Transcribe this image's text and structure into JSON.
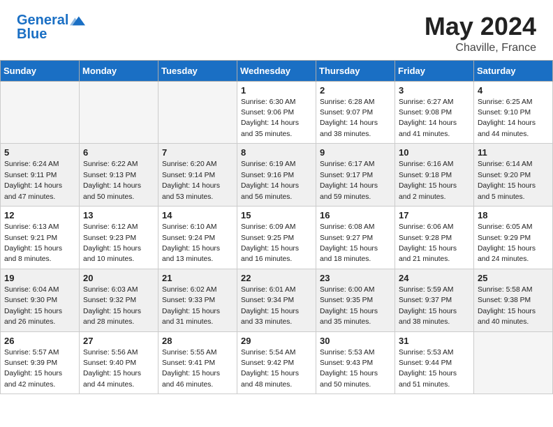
{
  "header": {
    "logo_line1": "General",
    "logo_line2": "Blue",
    "month": "May 2024",
    "location": "Chaville, France"
  },
  "weekdays": [
    "Sunday",
    "Monday",
    "Tuesday",
    "Wednesday",
    "Thursday",
    "Friday",
    "Saturday"
  ],
  "weeks": [
    [
      {
        "day": "",
        "sunrise": "",
        "sunset": "",
        "daylight": "",
        "empty": true
      },
      {
        "day": "",
        "sunrise": "",
        "sunset": "",
        "daylight": "",
        "empty": true
      },
      {
        "day": "",
        "sunrise": "",
        "sunset": "",
        "daylight": "",
        "empty": true
      },
      {
        "day": "1",
        "sunrise": "Sunrise: 6:30 AM",
        "sunset": "Sunset: 9:06 PM",
        "daylight": "Daylight: 14 hours and 35 minutes.",
        "empty": false
      },
      {
        "day": "2",
        "sunrise": "Sunrise: 6:28 AM",
        "sunset": "Sunset: 9:07 PM",
        "daylight": "Daylight: 14 hours and 38 minutes.",
        "empty": false
      },
      {
        "day": "3",
        "sunrise": "Sunrise: 6:27 AM",
        "sunset": "Sunset: 9:08 PM",
        "daylight": "Daylight: 14 hours and 41 minutes.",
        "empty": false
      },
      {
        "day": "4",
        "sunrise": "Sunrise: 6:25 AM",
        "sunset": "Sunset: 9:10 PM",
        "daylight": "Daylight: 14 hours and 44 minutes.",
        "empty": false
      }
    ],
    [
      {
        "day": "5",
        "sunrise": "Sunrise: 6:24 AM",
        "sunset": "Sunset: 9:11 PM",
        "daylight": "Daylight: 14 hours and 47 minutes.",
        "empty": false
      },
      {
        "day": "6",
        "sunrise": "Sunrise: 6:22 AM",
        "sunset": "Sunset: 9:13 PM",
        "daylight": "Daylight: 14 hours and 50 minutes.",
        "empty": false
      },
      {
        "day": "7",
        "sunrise": "Sunrise: 6:20 AM",
        "sunset": "Sunset: 9:14 PM",
        "daylight": "Daylight: 14 hours and 53 minutes.",
        "empty": false
      },
      {
        "day": "8",
        "sunrise": "Sunrise: 6:19 AM",
        "sunset": "Sunset: 9:16 PM",
        "daylight": "Daylight: 14 hours and 56 minutes.",
        "empty": false
      },
      {
        "day": "9",
        "sunrise": "Sunrise: 6:17 AM",
        "sunset": "Sunset: 9:17 PM",
        "daylight": "Daylight: 14 hours and 59 minutes.",
        "empty": false
      },
      {
        "day": "10",
        "sunrise": "Sunrise: 6:16 AM",
        "sunset": "Sunset: 9:18 PM",
        "daylight": "Daylight: 15 hours and 2 minutes.",
        "empty": false
      },
      {
        "day": "11",
        "sunrise": "Sunrise: 6:14 AM",
        "sunset": "Sunset: 9:20 PM",
        "daylight": "Daylight: 15 hours and 5 minutes.",
        "empty": false
      }
    ],
    [
      {
        "day": "12",
        "sunrise": "Sunrise: 6:13 AM",
        "sunset": "Sunset: 9:21 PM",
        "daylight": "Daylight: 15 hours and 8 minutes.",
        "empty": false
      },
      {
        "day": "13",
        "sunrise": "Sunrise: 6:12 AM",
        "sunset": "Sunset: 9:23 PM",
        "daylight": "Daylight: 15 hours and 10 minutes.",
        "empty": false
      },
      {
        "day": "14",
        "sunrise": "Sunrise: 6:10 AM",
        "sunset": "Sunset: 9:24 PM",
        "daylight": "Daylight: 15 hours and 13 minutes.",
        "empty": false
      },
      {
        "day": "15",
        "sunrise": "Sunrise: 6:09 AM",
        "sunset": "Sunset: 9:25 PM",
        "daylight": "Daylight: 15 hours and 16 minutes.",
        "empty": false
      },
      {
        "day": "16",
        "sunrise": "Sunrise: 6:08 AM",
        "sunset": "Sunset: 9:27 PM",
        "daylight": "Daylight: 15 hours and 18 minutes.",
        "empty": false
      },
      {
        "day": "17",
        "sunrise": "Sunrise: 6:06 AM",
        "sunset": "Sunset: 9:28 PM",
        "daylight": "Daylight: 15 hours and 21 minutes.",
        "empty": false
      },
      {
        "day": "18",
        "sunrise": "Sunrise: 6:05 AM",
        "sunset": "Sunset: 9:29 PM",
        "daylight": "Daylight: 15 hours and 24 minutes.",
        "empty": false
      }
    ],
    [
      {
        "day": "19",
        "sunrise": "Sunrise: 6:04 AM",
        "sunset": "Sunset: 9:30 PM",
        "daylight": "Daylight: 15 hours and 26 minutes.",
        "empty": false
      },
      {
        "day": "20",
        "sunrise": "Sunrise: 6:03 AM",
        "sunset": "Sunset: 9:32 PM",
        "daylight": "Daylight: 15 hours and 28 minutes.",
        "empty": false
      },
      {
        "day": "21",
        "sunrise": "Sunrise: 6:02 AM",
        "sunset": "Sunset: 9:33 PM",
        "daylight": "Daylight: 15 hours and 31 minutes.",
        "empty": false
      },
      {
        "day": "22",
        "sunrise": "Sunrise: 6:01 AM",
        "sunset": "Sunset: 9:34 PM",
        "daylight": "Daylight: 15 hours and 33 minutes.",
        "empty": false
      },
      {
        "day": "23",
        "sunrise": "Sunrise: 6:00 AM",
        "sunset": "Sunset: 9:35 PM",
        "daylight": "Daylight: 15 hours and 35 minutes.",
        "empty": false
      },
      {
        "day": "24",
        "sunrise": "Sunrise: 5:59 AM",
        "sunset": "Sunset: 9:37 PM",
        "daylight": "Daylight: 15 hours and 38 minutes.",
        "empty": false
      },
      {
        "day": "25",
        "sunrise": "Sunrise: 5:58 AM",
        "sunset": "Sunset: 9:38 PM",
        "daylight": "Daylight: 15 hours and 40 minutes.",
        "empty": false
      }
    ],
    [
      {
        "day": "26",
        "sunrise": "Sunrise: 5:57 AM",
        "sunset": "Sunset: 9:39 PM",
        "daylight": "Daylight: 15 hours and 42 minutes.",
        "empty": false
      },
      {
        "day": "27",
        "sunrise": "Sunrise: 5:56 AM",
        "sunset": "Sunset: 9:40 PM",
        "daylight": "Daylight: 15 hours and 44 minutes.",
        "empty": false
      },
      {
        "day": "28",
        "sunrise": "Sunrise: 5:55 AM",
        "sunset": "Sunset: 9:41 PM",
        "daylight": "Daylight: 15 hours and 46 minutes.",
        "empty": false
      },
      {
        "day": "29",
        "sunrise": "Sunrise: 5:54 AM",
        "sunset": "Sunset: 9:42 PM",
        "daylight": "Daylight: 15 hours and 48 minutes.",
        "empty": false
      },
      {
        "day": "30",
        "sunrise": "Sunrise: 5:53 AM",
        "sunset": "Sunset: 9:43 PM",
        "daylight": "Daylight: 15 hours and 50 minutes.",
        "empty": false
      },
      {
        "day": "31",
        "sunrise": "Sunrise: 5:53 AM",
        "sunset": "Sunset: 9:44 PM",
        "daylight": "Daylight: 15 hours and 51 minutes.",
        "empty": false
      },
      {
        "day": "",
        "sunrise": "",
        "sunset": "",
        "daylight": "",
        "empty": true
      }
    ]
  ]
}
